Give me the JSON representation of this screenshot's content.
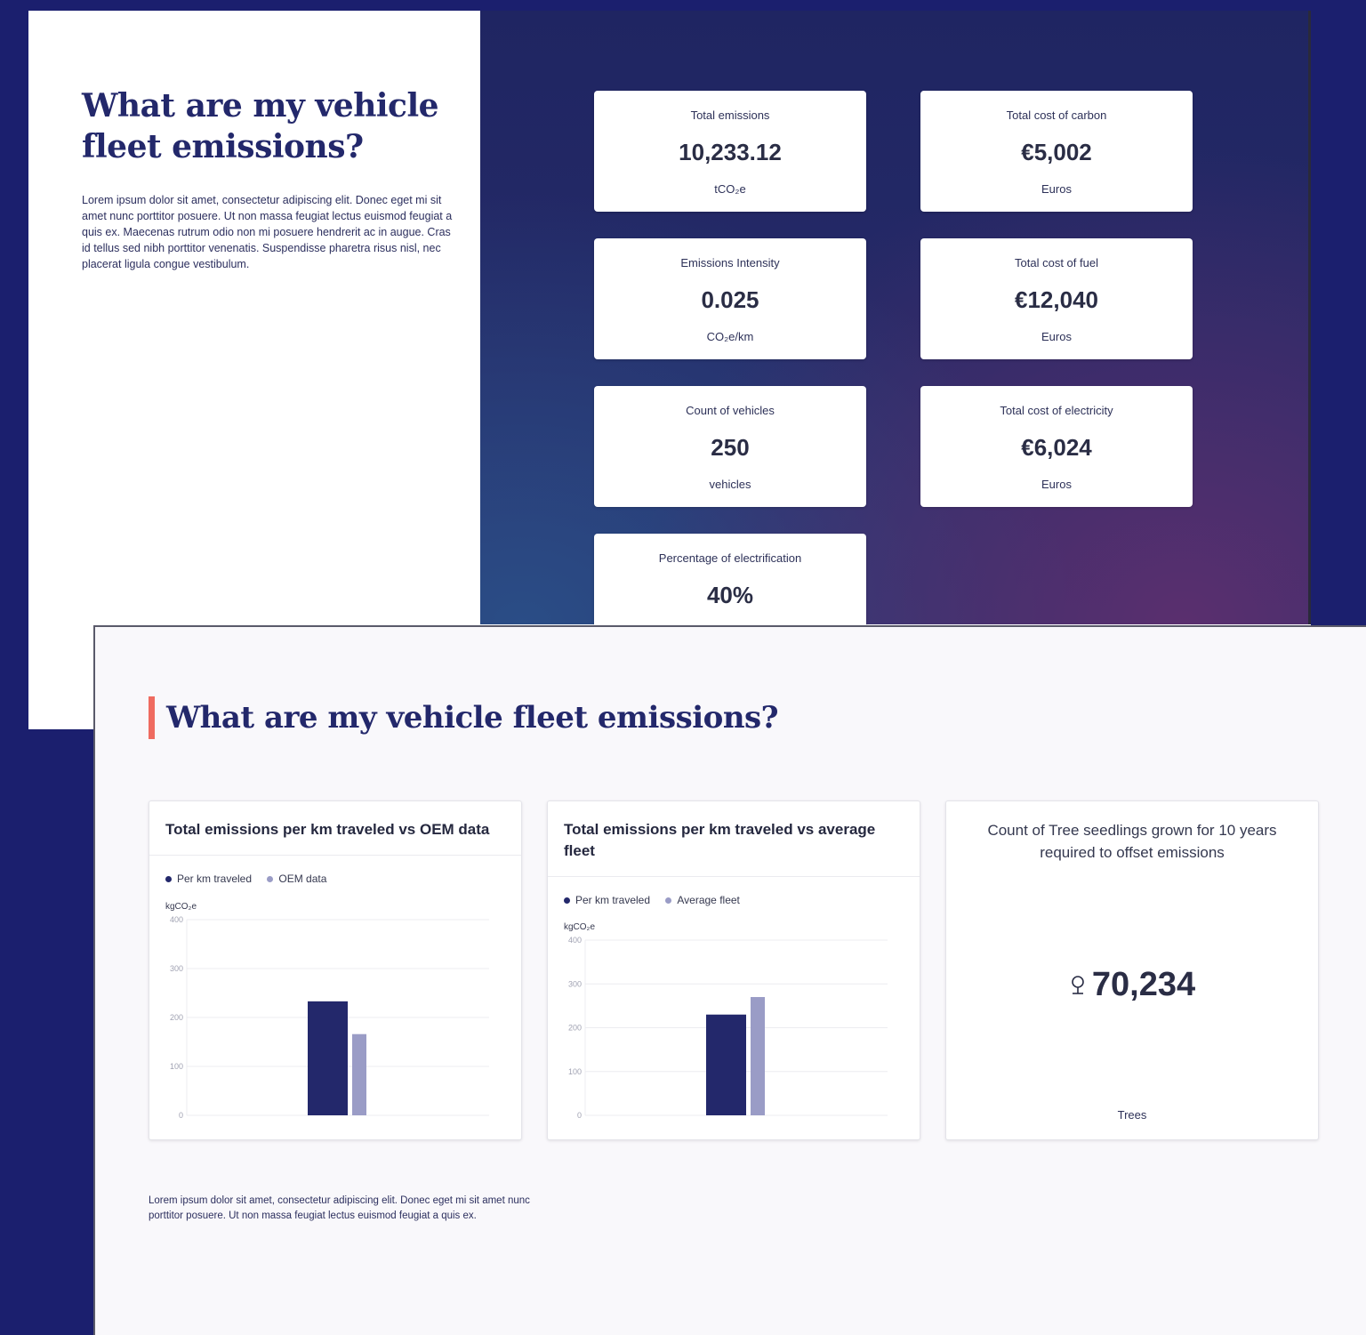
{
  "top_slide": {
    "title": "What are my vehicle fleet emissions?",
    "intro": "Lorem ipsum dolor sit amet, consectetur adipiscing elit. Donec eget mi sit amet nunc porttitor posuere. Ut non massa feugiat lectus euismod feugiat a quis ex. Maecenas rutrum odio non mi posuere hendrerit ac in augue. Cras id tellus sed nibh porttitor venenatis. Suspendisse pharetra risus nisl, nec placerat ligula congue vestibulum.",
    "kpis": [
      {
        "label": "Total emissions",
        "value": "10,233.12",
        "unit": "tCO₂e"
      },
      {
        "label": "Total cost of carbon",
        "value": "€5,002",
        "unit": "Euros"
      },
      {
        "label": "Emissions Intensity",
        "value": "0.025",
        "unit": "CO₂e/km"
      },
      {
        "label": "Total cost of fuel",
        "value": "€12,040",
        "unit": "Euros"
      },
      {
        "label": "Count of vehicles",
        "value": "250",
        "unit": "vehicles"
      },
      {
        "label": "Total cost of electricity",
        "value": "€6,024",
        "unit": "Euros"
      },
      {
        "label": "Percentage of electrification",
        "value": "40%",
        "unit": ""
      }
    ]
  },
  "bottom_slide": {
    "title": "What are my vehicle fleet emissions?",
    "footnote": "Lorem ipsum dolor sit amet, consectetur adipiscing elit. Donec eget mi sit amet nunc porttitor posuere. Ut non massa feugiat lectus euismod feugiat a quis ex.",
    "tree_card": {
      "title": "Count of Tree seedlings grown for 10 years required to offset emissions",
      "value": "70,234",
      "unit": "Trees",
      "icon": "tree-icon"
    }
  },
  "colors": {
    "navy": "#23286b",
    "lavender": "#9a9cc6",
    "accent": "#ef6b60",
    "background": "#1b1f6e"
  },
  "chart_data": [
    {
      "type": "bar",
      "title": "Total emissions per km traveled vs OEM data",
      "ylabel": "kgCO₂e",
      "ylim": [
        0,
        400
      ],
      "yticks": [
        0,
        100,
        200,
        300,
        400
      ],
      "grid": true,
      "legend": "top-left",
      "series": [
        {
          "name": "Per km traveled",
          "values": [
            233
          ],
          "color": "#23286b"
        },
        {
          "name": "OEM data",
          "values": [
            166
          ],
          "color": "#9a9cc6"
        }
      ]
    },
    {
      "type": "bar",
      "title": "Total emissions per km traveled vs average fleet",
      "ylabel": "kgCO₂e",
      "ylim": [
        0,
        400
      ],
      "yticks": [
        0,
        100,
        200,
        300,
        400
      ],
      "grid": true,
      "legend": "top-left",
      "series": [
        {
          "name": "Per km traveled",
          "values": [
            230
          ],
          "color": "#23286b"
        },
        {
          "name": "Average fleet",
          "values": [
            270
          ],
          "color": "#9a9cc6"
        }
      ]
    }
  ]
}
